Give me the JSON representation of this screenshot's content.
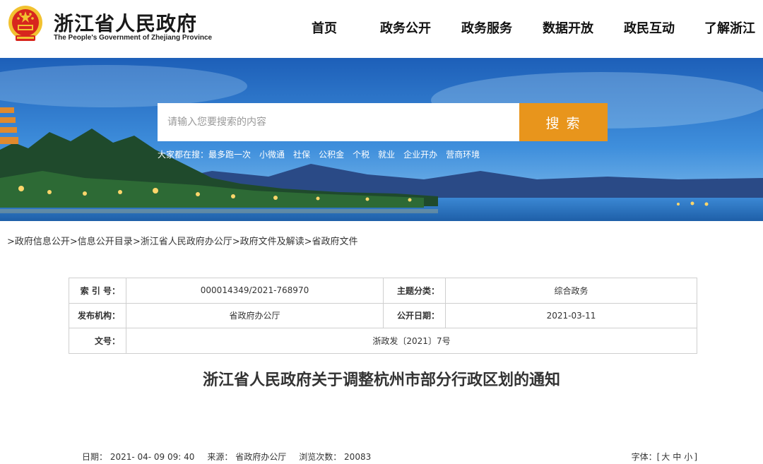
{
  "header": {
    "title": "浙江省人民政府",
    "subtitle": "The People's Government of Zhejiang Province",
    "nav": [
      "首页",
      "政务公开",
      "政务服务",
      "数据开放",
      "政民互动",
      "了解浙江"
    ]
  },
  "search": {
    "placeholder": "请输入您要搜索的内容",
    "button": "搜索",
    "hot_label": "大家都在搜：",
    "hot_items": [
      "最多跑一次",
      "小微通",
      "社保",
      "公积金",
      "个税",
      "就业",
      "企业开办",
      "营商环境"
    ]
  },
  "breadcrumb": [
    ">政府信息公开",
    ">信息公开目录",
    ">浙江省人民政府办公厅",
    ">政府文件及解读",
    ">省政府文件"
  ],
  "meta": {
    "index_label": "索 引 号：",
    "index_value": "000014349/2021-768970",
    "topic_label": "主题分类：",
    "topic_value": "综合政务",
    "publisher_label": "发布机构：",
    "publisher_value": "省政府办公厅",
    "date_label": "公开日期：",
    "date_value": "2021-03-11",
    "doc_no_label": "文号：",
    "doc_no_value": "浙政发〔2021〕7号"
  },
  "doc_title": "浙江省人民政府关于调整杭州市部分行政区划的通知",
  "info": {
    "date": "日期： 2021- 04- 09 09: 40",
    "source": "来源： 省政府办公厅",
    "views": "浏览次数： 20083",
    "font_label": "字体：[",
    "font_large": "大",
    "font_medium": "中",
    "font_small": "小",
    "font_close": "]"
  },
  "colors": {
    "accent": "#e8951c",
    "banner_sky": "#2f7fd0",
    "emblem_red": "#d7261e",
    "emblem_gold": "#f2c230"
  }
}
